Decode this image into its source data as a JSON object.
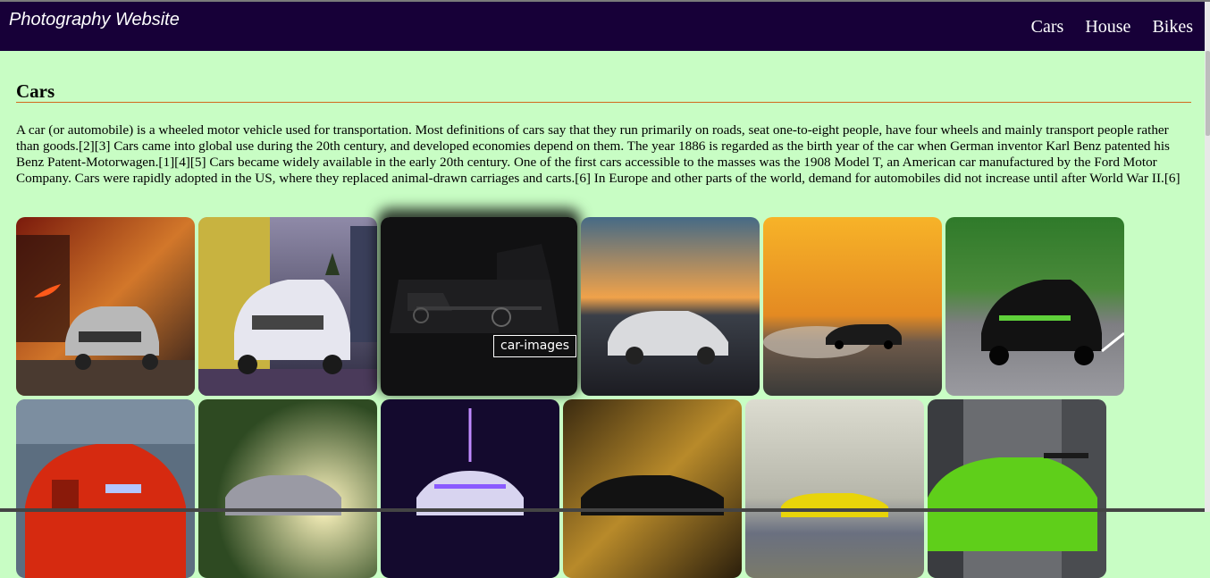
{
  "navbar": {
    "brand": "Photography Website",
    "links": [
      "Cars",
      "House",
      "Bikes"
    ]
  },
  "section": {
    "title": "Cars",
    "paragraph": "A car (or automobile) is a wheeled motor vehicle used for transportation. Most definitions of cars say that they run primarily on roads, seat one-to-eight people, have four wheels and mainly transport people rather than goods.[2][3] Cars came into global use during the 20th century, and developed economies depend on them. The year 1886 is regarded as the birth year of the car when German inventor Karl Benz patented his Benz Patent-Motorwagen.[1][4][5] Cars became widely available in the early 20th century. One of the first cars accessible to the masses was the 1908 Model T, an American car manufactured by the Ford Motor Company. Cars were rapidly adopted in the US, where they replaced animal-drawn carriages and carts.[6] In Europe and other parts of the world, demand for automobiles did not increase until after World War II.[6]"
  },
  "gallery": {
    "tooltip": "car-images",
    "row1_count": 6,
    "row2_count": 6
  },
  "colors": {
    "page_background": "#c8fdc4",
    "navbar": "#170038",
    "section_rule": "#d2691e"
  }
}
